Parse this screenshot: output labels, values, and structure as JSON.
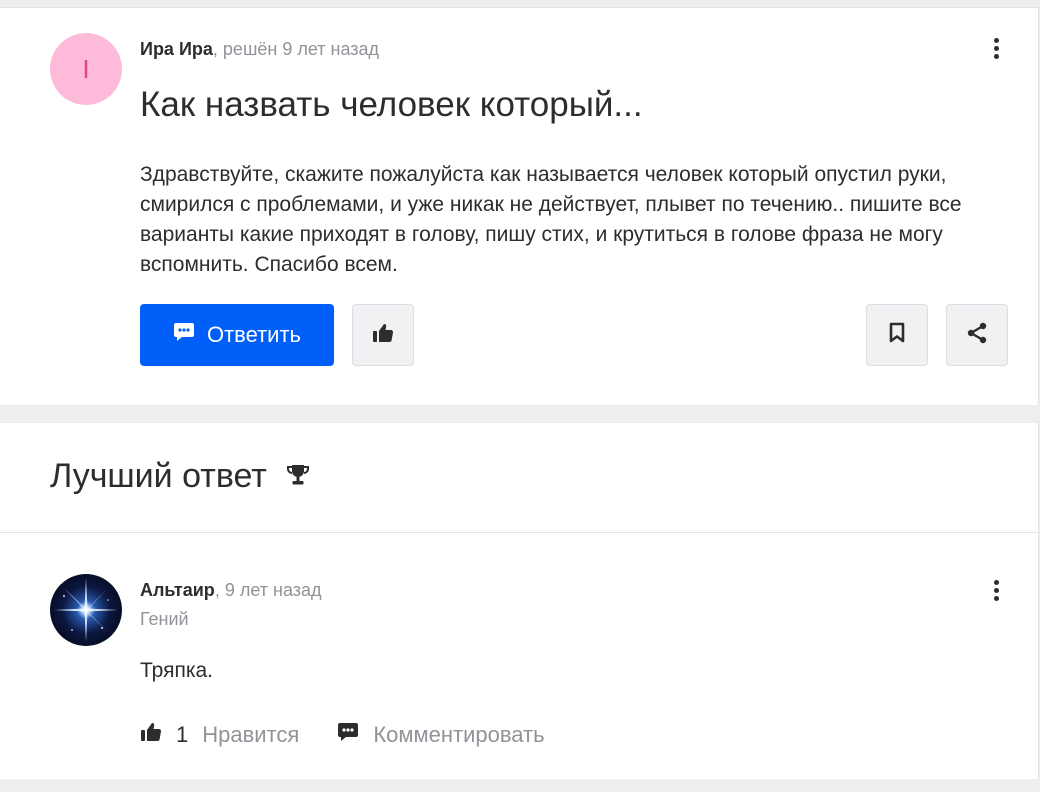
{
  "question": {
    "author": "Ира Ира",
    "separator": ",",
    "status_time": "решён 9 лет назад",
    "avatar_letter": "I",
    "title": "Как назвать человек который...",
    "text": "Здравствуйте, скажите пожалуйста как называется человек который опустил руки, смирился с проблемами, и уже никак не действует, плывет по течению.. пишите все варианты какие приходят в голову, пишу стих, и крутиться в голове фраза не могу вспомнить. Спасибо всем.",
    "reply_label": "Ответить"
  },
  "best_answer": {
    "heading": "Лучший ответ",
    "author": "Альтаир",
    "separator": ",",
    "time": "9 лет назад",
    "rank": "Гений",
    "text": "Тряпка.",
    "like_count": "1",
    "like_label": "Нравится",
    "comment_label": "Комментировать"
  },
  "colors": {
    "accent": "#005ff9",
    "avatar_bg": "#fdbad9",
    "avatar_letter": "#e0457e",
    "muted": "#919399"
  },
  "icons": [
    "kebab-icon",
    "chat-bubble-icon",
    "thumbs-up-icon",
    "bookmark-icon",
    "share-icon",
    "trophy-icon",
    "comment-icon"
  ]
}
